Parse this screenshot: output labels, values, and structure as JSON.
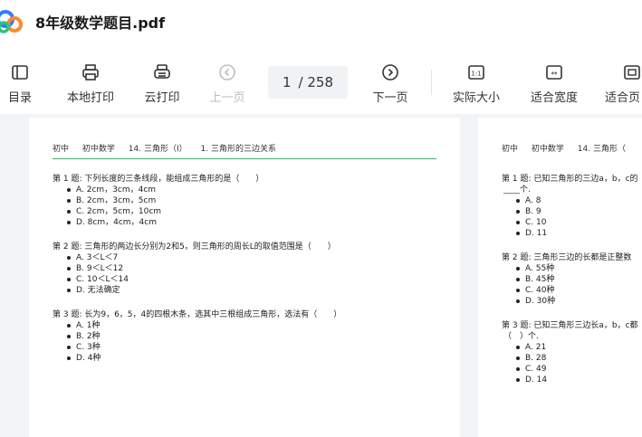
{
  "app": {
    "file_title": "8年级数学题目.pdf",
    "brand_colors": {
      "logo_blue": "#2f7cf6",
      "logo_orange": "#ff8a2a",
      "logo_green": "#2ec47a"
    }
  },
  "toolbar": {
    "toc_label": "目录",
    "local_print_label": "本地打印",
    "cloud_print_label": "云打印",
    "prev_page_label": "上一页",
    "current_page": "1",
    "total_pages": "/ 258",
    "next_page_label": "下一页",
    "actual_size_label": "实际大小",
    "actual_size_icon_text": "1:1",
    "fit_width_label": "适合宽度",
    "fit_width_icon_text": "↔",
    "fit_page_label": "适合页"
  },
  "page1": {
    "breadcrumbs": [
      "初中",
      "初中数学",
      "14. 三角形（I）",
      "1. 三角形的三边关系"
    ],
    "questions": [
      {
        "title": "第 1 题: 下列长度的三条线段，能组成三角形的是（　　）",
        "options": [
          "A. 2cm，3cm，4cm",
          "B. 2cm，3cm，5cm",
          "C. 2cm，5cm，10cm",
          "D. 8cm，4cm，4cm"
        ]
      },
      {
        "title": "第 2 题: 三角形的两边长分别为2和5，则三角形的周长L的取值范围是（　　）",
        "options": [
          "A. 3＜L＜7",
          "B. 9＜L＜12",
          "C. 10＜L＜14",
          "D. 无法确定"
        ]
      },
      {
        "title": "第 3 题: 长为9，6，5，4的四根木条，选其中三根组成三角形，选法有（　　）",
        "options": [
          "A. 1种",
          "B. 2种",
          "C. 3种",
          "D. 4种"
        ]
      }
    ]
  },
  "page2": {
    "breadcrumbs": [
      "初中",
      "初中数学",
      "14. 三角形（"
    ],
    "questions": [
      {
        "title": "第 1 题: 已知三角形的三边a，b，c的",
        "blank": "____个.",
        "options": [
          "A. 8",
          "B. 9",
          "C. 10",
          "D. 11"
        ]
      },
      {
        "title": "第 2 题: 三角形三边的长都是正整数",
        "options": [
          "A. 55种",
          "B. 45种",
          "C. 40种",
          "D. 30种"
        ]
      },
      {
        "title": "第 3 题: 已知三角形三边长a，b，c都",
        "blank": "（　）个.",
        "options": [
          "A. 21",
          "B. 28",
          "C. 49",
          "D. 14"
        ]
      }
    ]
  }
}
